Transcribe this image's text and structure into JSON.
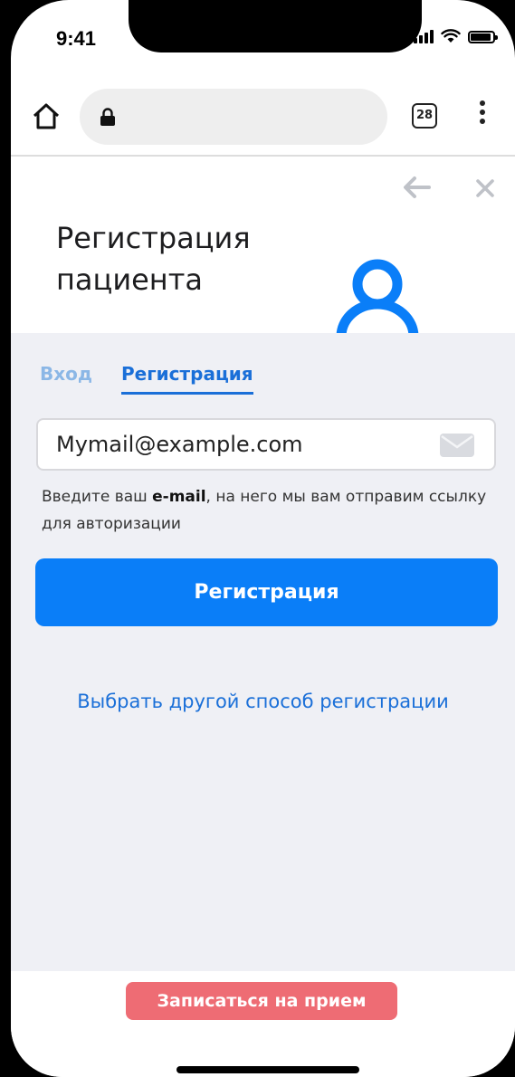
{
  "status_bar": {
    "time": "9:41"
  },
  "browser": {
    "tab_count": "28"
  },
  "header": {
    "title": "Регистрация пациента"
  },
  "tabs": [
    {
      "label": "Вход",
      "active": false
    },
    {
      "label": "Регистрация",
      "active": true
    }
  ],
  "form": {
    "email_value": "Mymail@example.com",
    "hint_prefix": "Введите ваш ",
    "hint_bold": "e-mail",
    "hint_suffix": ", на него мы вам отправим ссылку для авторизации",
    "submit_label": "Регистрация",
    "alt_link": "Выбрать другой способ регистрации"
  },
  "footer": {
    "appointment_label": "Записаться на прием"
  },
  "colors": {
    "accent": "#0a7ef8",
    "link": "#1a6fd8",
    "appointment": "#ee6c74",
    "background": "#eff0f5"
  },
  "icons": [
    "home-icon",
    "lock-icon",
    "tabs-icon",
    "more-icon",
    "back-arrow-icon",
    "close-icon",
    "user-icon",
    "mail-icon"
  ]
}
